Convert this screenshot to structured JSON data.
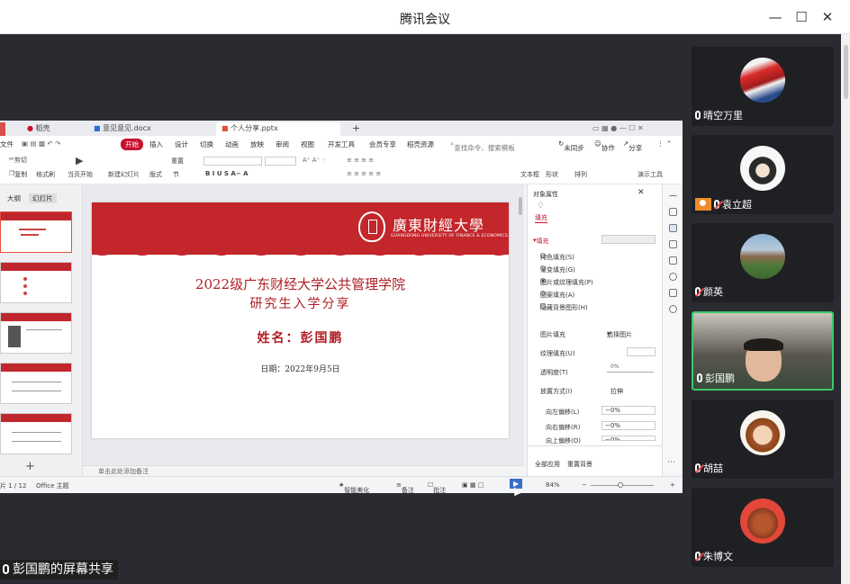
{
  "window": {
    "title": "腾讯会议"
  },
  "share": {
    "label": "彭国鹏的屏幕共享"
  },
  "wps": {
    "tabs": [
      "稻壳",
      "意见意见.docx",
      "个人分享.pptx"
    ],
    "menu": [
      "文件",
      "开始",
      "插入",
      "设计",
      "切换",
      "动画",
      "放映",
      "审阅",
      "视图",
      "开发工具",
      "会员专享",
      "稻壳资源",
      "查找命令、搜索模板",
      "未同步",
      "协作",
      "分享"
    ],
    "toolbar": [
      "剪切",
      "复制",
      "格式刷",
      "当页开始",
      "新建幻灯片",
      "版式",
      "节",
      "重置",
      "文本框",
      "形状",
      "排列",
      "演示工具"
    ],
    "thumbs_header": [
      "大纲",
      "幻灯片"
    ],
    "notes": "单击此处添加备注",
    "slide": {
      "school": "廣東財經大學",
      "school_en": "GUANGDONG UNIVERSITY OF FINANCE & ECONOMICS",
      "title1": "2022级广东财经大学公共管理学院",
      "title2": "研究生入学分享",
      "name": "姓名：彭国鹏",
      "date": "日期：2022年9月5日"
    },
    "props": {
      "header": "对象属性",
      "tab": "填充",
      "section": "填充",
      "options": [
        "纯色填充(S)",
        "渐变填充(G)",
        "图片或纹理填充(P)",
        "图案填充(A)",
        "隐藏背景图形(H)"
      ],
      "selected_option": 2,
      "picture_fill_label": "图片填充",
      "picture_fill_value": "选择图片",
      "texture_label": "纹理填充(U)",
      "transparency_label": "透明度(T)",
      "transparency_value": "0%",
      "placement_label": "放置方式(I)",
      "placement_value": "拉伸",
      "offset_left_label": "向左偏移(L)",
      "offset_right_label": "向右偏移(R)",
      "offset_up_label": "向上偏移(O)",
      "offset_value": "0%",
      "apply_all": "全部应用",
      "reset_bg": "重置背景"
    },
    "status": {
      "slide_count": "片 1 / 12",
      "theme": "Office 主题",
      "smart": "智能美化",
      "comment_btn": "备注",
      "annotate_btn": "批注",
      "zoom": "84%"
    }
  },
  "participants": [
    {
      "name": "晴空万里",
      "muted": false,
      "host": false
    },
    {
      "name": "袁立超",
      "muted": true,
      "host": true
    },
    {
      "name": "颜英",
      "muted": true,
      "host": false
    },
    {
      "name": "彭国鹏",
      "muted": false,
      "host": false,
      "active": true
    },
    {
      "name": "胡喆",
      "muted": true,
      "host": false
    },
    {
      "name": "朱博文",
      "muted": true,
      "host": false
    }
  ]
}
